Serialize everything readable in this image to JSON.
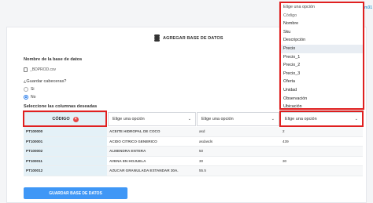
{
  "top_label": "m31",
  "header": {
    "title": "AGREGAR BASE DE DATOS",
    "icon": "database-icon"
  },
  "form": {
    "db_name_label": "Nombre de la base de datos",
    "file_name": "_BDPROD.csv",
    "headers_question": "¿Guardar cabeceras?",
    "option_yes": "Si",
    "option_no": "No",
    "selected_option": "No",
    "columns_label": "Seleccione las columnas deseadas"
  },
  "columns": [
    {
      "label": "CÓDIGO",
      "selected": true
    },
    {
      "label": "Elige una opción",
      "selected": false
    },
    {
      "label": "Elige una opción",
      "selected": false
    },
    {
      "label": "Elige una opción",
      "selected": false
    }
  ],
  "rows": [
    [
      "PT100000",
      "ACEITE HIDROPAL DE COCO",
      "asd",
      "2"
    ],
    [
      "PT100001",
      "ACIDO CITRICO GENERICO",
      "asdasds",
      "439"
    ],
    [
      "PT100002",
      "ALMENDRA ENTERA",
      "50",
      ""
    ],
    [
      "PT100011",
      "AVENA EN HOJUELA",
      "30",
      "30"
    ],
    [
      "PT100012",
      "AZUCAR GRANULADA ESTANDAR 30A.",
      "55.5",
      ""
    ]
  ],
  "dropdown": {
    "header": "Elige una opción",
    "options": [
      "Código",
      "Nombre",
      "Sku",
      "Descripción",
      "Precio",
      "Precio_1",
      "Precio_2",
      "Precio_3",
      "Oferta",
      "Unidad",
      "Observación",
      "Ubicación"
    ],
    "highlighted": "Precio"
  },
  "submit_label": "GUARDAR BASE DE DATOS",
  "colors": {
    "accent": "#3f97f6",
    "highlight_border": "#e02020",
    "selected_col_bg": "#e4f1f7",
    "remove_badge": "#e64545"
  }
}
